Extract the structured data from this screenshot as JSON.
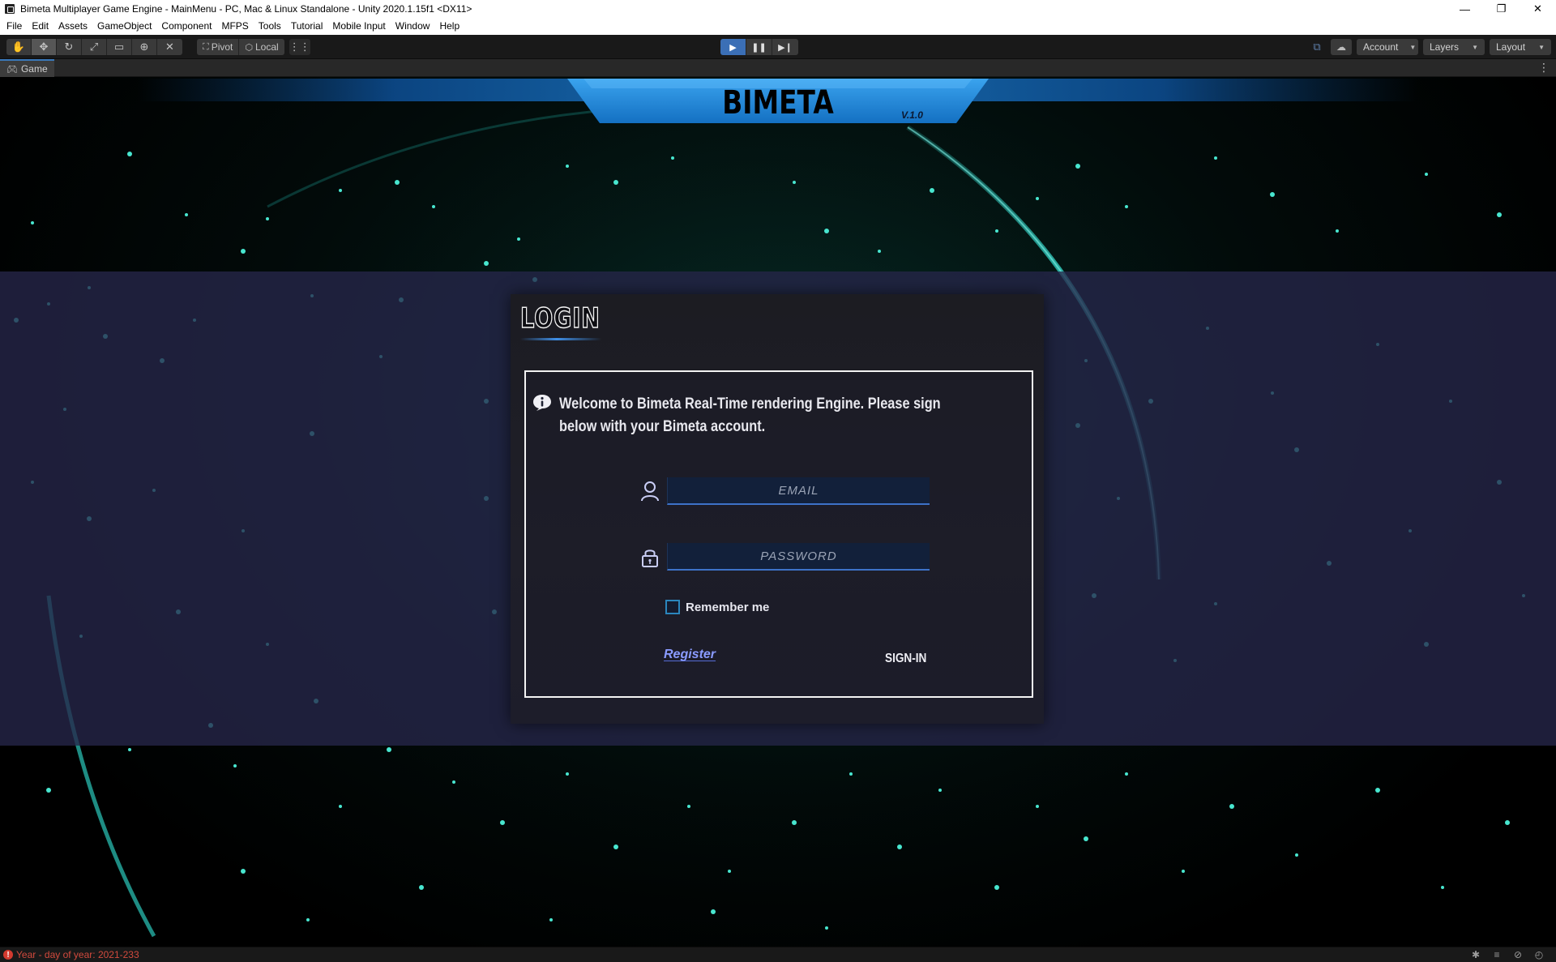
{
  "window": {
    "title": "Bimeta Multiplayer Game Engine - MainMenu - PC, Mac & Linux Standalone - Unity 2020.1.15f1 <DX11>",
    "controls": {
      "minimize": "—",
      "restore": "❐",
      "close": "✕"
    }
  },
  "menu": [
    "File",
    "Edit",
    "Assets",
    "GameObject",
    "Component",
    "MFPS",
    "Tools",
    "Tutorial",
    "Mobile Input",
    "Window",
    "Help"
  ],
  "toolbar": {
    "pivot_label": "Pivot",
    "local_label": "Local",
    "account_label": "Account",
    "layers_label": "Layers",
    "layout_label": "Layout"
  },
  "game_tab": {
    "label": "Game"
  },
  "game": {
    "banner_title": "BIMETA",
    "banner_version": "V.1.0",
    "login_title": "LOGIN",
    "welcome_text": "Welcome to Bimeta Real-Time rendering Engine. Please sign below with your Bimeta account.",
    "email_placeholder": "EMAIL",
    "password_placeholder": "PASSWORD",
    "remember_label": "Remember me",
    "remember_checked": false,
    "register_label": "Register",
    "signin_label": "SIGN-IN"
  },
  "status": {
    "message": "Year - day of year: 2021-233",
    "level": "error"
  },
  "colors": {
    "accent_blue": "#3b6fb6",
    "banner_blue": "#1d7fd0",
    "error_red": "#d24a3d",
    "register_link": "#8a9bff"
  }
}
